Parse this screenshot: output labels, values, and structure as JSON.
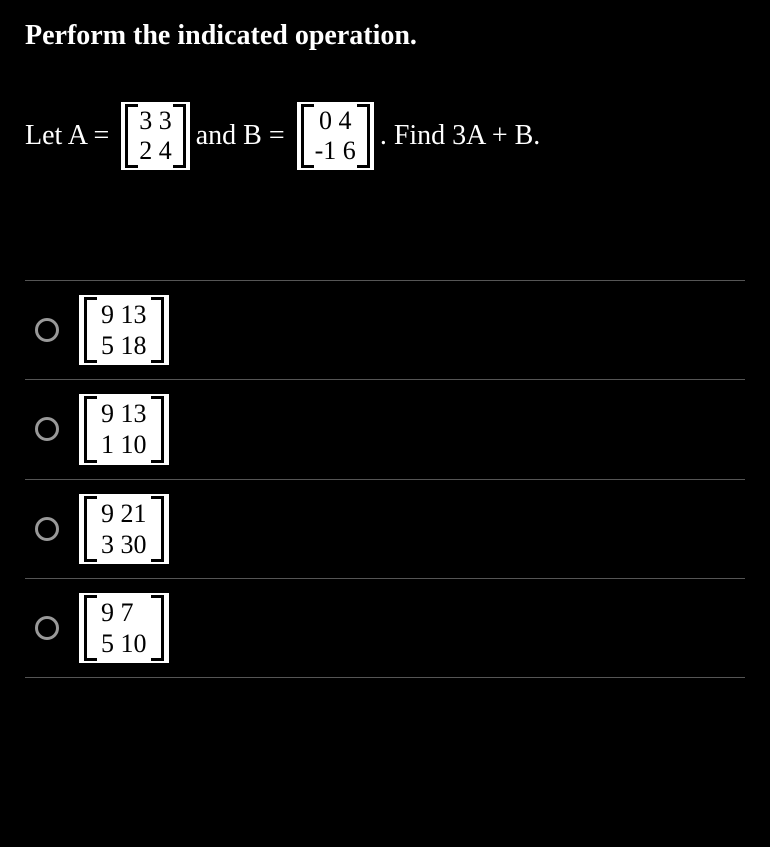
{
  "title": "Perform the indicated operation.",
  "problem": {
    "let_a": "Let A =",
    "matrix_a": {
      "row1": "3 3",
      "row2": "2 4"
    },
    "and_b": "and B =",
    "matrix_b": {
      "row1": " 0 4",
      "row2": "-1 6"
    },
    "find": ". Find 3A + B."
  },
  "answers": [
    {
      "row1": "9 13",
      "row2": "5 18"
    },
    {
      "row1": "9 13",
      "row2": "1 10"
    },
    {
      "row1": "9 21",
      "row2": "3 30"
    },
    {
      "row1": "9  7",
      "row2": "5 10"
    }
  ]
}
